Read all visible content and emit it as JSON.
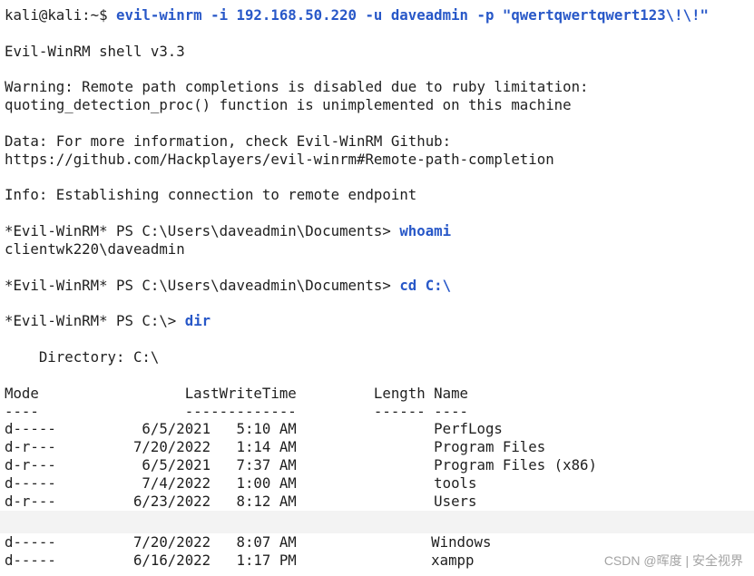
{
  "colors": {
    "background": "#ffffff",
    "text": "#1f1f1f",
    "command": "#2858c8",
    "band": "#f3f3f3",
    "watermark": "#a3a3a3"
  },
  "terminal": {
    "login": {
      "prompt": "kali@kali:~$",
      "command": "evil-winrm -i 192.168.50.220 -u daveadmin -p \"qwertqwertqwert123\\!\\!\""
    },
    "banner": "Evil-WinRM shell v3.3",
    "warning": [
      "Warning: Remote path completions is disabled due to ruby limitation:",
      "quoting_detection_proc() function is unimplemented on this machine"
    ],
    "data_notice": [
      "Data: For more information, check Evil-WinRM Github:",
      "https://github.com/Hackplayers/evil-winrm#Remote-path-completion"
    ],
    "info": "Info: Establishing connection to remote endpoint",
    "commands": [
      {
        "prompt": "*Evil-WinRM* PS C:\\Users\\daveadmin\\Documents>",
        "command": "whoami",
        "output": "clientwk220\\daveadmin"
      },
      {
        "prompt": "*Evil-WinRM* PS C:\\Users\\daveadmin\\Documents>",
        "command": "cd C:\\"
      },
      {
        "prompt": "*Evil-WinRM* PS C:\\>",
        "command": "dir"
      }
    ]
  },
  "listing": {
    "directory": "Directory: C:\\",
    "columns": {
      "mode": "Mode",
      "last_write_time": "LastWriteTime",
      "length": "Length",
      "name": "Name"
    },
    "column_rules": {
      "mode": "----",
      "last_write_time": "-------------",
      "length": "------",
      "name": "----"
    },
    "rows": [
      {
        "mode": "d-----",
        "date": "6/5/2021",
        "time": "5:10 AM",
        "name": "PerfLogs"
      },
      {
        "mode": "d-r---",
        "date": "7/20/2022",
        "time": "1:14 AM",
        "name": "Program Files"
      },
      {
        "mode": "d-r---",
        "date": "6/5/2021",
        "time": "7:37 AM",
        "name": "Program Files (x86)"
      },
      {
        "mode": "d-----",
        "date": "7/4/2022",
        "time": "1:00 AM",
        "name": "tools"
      },
      {
        "mode": "d-r---",
        "date": "6/23/2022",
        "time": "8:12 AM",
        "name": "Users"
      },
      {
        "mode": "d-----",
        "date": "7/20/2022",
        "time": "8:07 AM",
        "name": "Windows"
      },
      {
        "mode": "d-----",
        "date": "6/16/2022",
        "time": "1:17 PM",
        "name": "xampp"
      }
    ]
  },
  "watermark": "CSDN @晖度 | 安全视界"
}
